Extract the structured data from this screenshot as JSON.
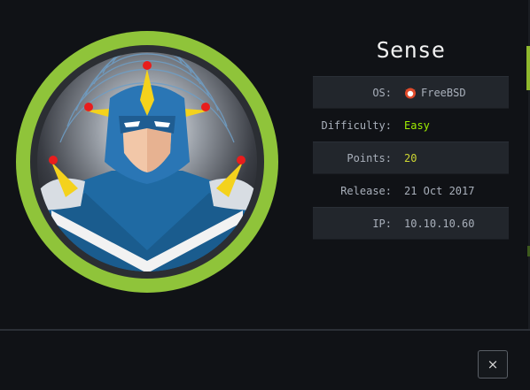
{
  "machine": {
    "name": "Sense"
  },
  "info": [
    {
      "key": "OS:",
      "value": "FreeBSD",
      "icon": "freebsd-icon",
      "style": "plain"
    },
    {
      "key": "Difficulty:",
      "value": "Easy",
      "style": "green"
    },
    {
      "key": "Points:",
      "value": "20",
      "style": "yellow"
    },
    {
      "key": "Release:",
      "value": "21 Oct 2017",
      "style": "plain"
    },
    {
      "key": "IP:",
      "value": "10.10.10.60",
      "style": "plain"
    }
  ],
  "footer": {
    "close_label": "×"
  },
  "colors": {
    "ring": "#8fc43a",
    "easy": "#9fef00",
    "points": "#cdd632",
    "os_icon": "#e04a2a"
  }
}
